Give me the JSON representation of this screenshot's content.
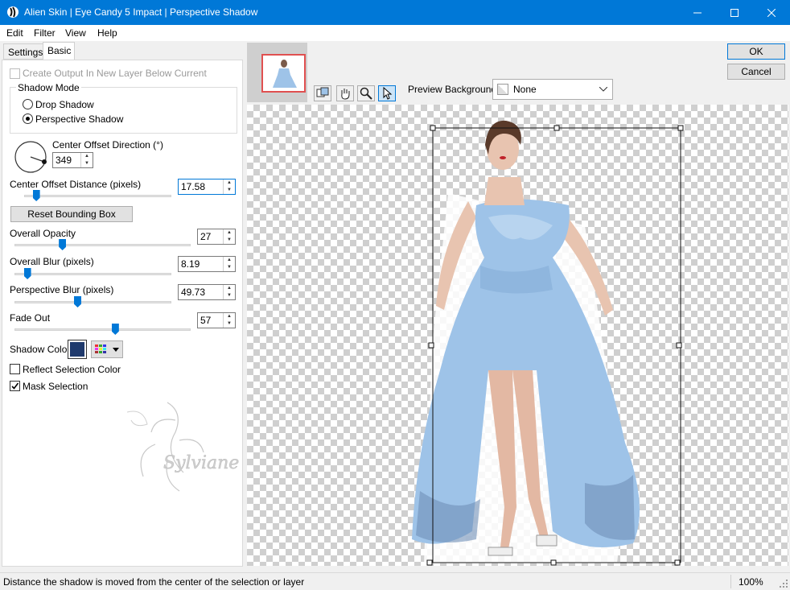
{
  "window": {
    "title": "Alien Skin | Eye Candy 5 Impact | Perspective Shadow"
  },
  "menu": [
    "Edit",
    "Filter",
    "View",
    "Help"
  ],
  "tabs": [
    "Settings",
    "Basic"
  ],
  "basic": {
    "create_output_label": "Create Output In New Layer Below Current",
    "shadow_mode_label": "Shadow Mode",
    "shadow_modes": [
      "Drop Shadow",
      "Perspective Shadow"
    ],
    "center_offset_direction_label": "Center Offset Direction (°)",
    "center_offset_direction_value": "349",
    "center_offset_distance_label": "Center Offset Distance (pixels)",
    "center_offset_distance_value": "17.58",
    "center_offset_distance_level": 0.08,
    "reset_bounding_box_label": "Reset Bounding Box",
    "overall_opacity_label": "Overall Opacity",
    "overall_opacity_value": "27",
    "overall_opacity_level": 0.27,
    "overall_blur_label": "Overall Blur (pixels)",
    "overall_blur_value": "8.19",
    "overall_blur_level": 0.08,
    "perspective_blur_label": "Perspective Blur (pixels)",
    "perspective_blur_value": "49.73",
    "perspective_blur_level": 0.4,
    "fade_out_label": "Fade Out",
    "fade_out_value": "57",
    "fade_out_level": 0.57,
    "shadow_color_label": "Shadow Color",
    "shadow_color": "#1f3a6d",
    "reflect_selection_color_label": "Reflect Selection Color",
    "mask_selection_label": "Mask Selection",
    "watermark_text": "Sylviane"
  },
  "preview": {
    "background_label": "Preview Background:",
    "background_value": "None",
    "tools": [
      "preview-compare-icon",
      "hand-icon",
      "zoom-icon",
      "pointer-icon"
    ]
  },
  "buttons": {
    "ok": "OK",
    "cancel": "Cancel"
  },
  "status": {
    "message": "Distance the shadow is moved from the center of the selection or layer",
    "zoom": "100%"
  },
  "colors": {
    "accent": "#0078d7",
    "dress": "#9ec3e8"
  }
}
